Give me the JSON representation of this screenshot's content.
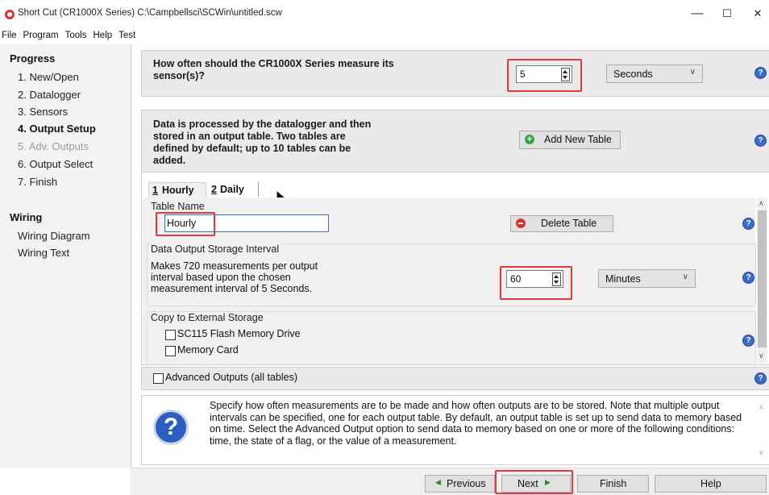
{
  "window": {
    "title": "Short Cut (CR1000X Series) C:\\Campbellsci\\SCWin\\untitled.scw",
    "minimize": "—",
    "maximize": "☐",
    "close": "✕"
  },
  "menu": [
    "File",
    "Program",
    "Tools",
    "Help",
    "Test"
  ],
  "sidebar": {
    "progress_heading": "Progress",
    "items": [
      {
        "label": "1. New/Open",
        "state": "normal"
      },
      {
        "label": "2. Datalogger",
        "state": "normal"
      },
      {
        "label": "3. Sensors",
        "state": "normal"
      },
      {
        "label": "4. Output Setup",
        "state": "current"
      },
      {
        "label": "5. Adv. Outputs",
        "state": "disabled"
      },
      {
        "label": "6. Output Select",
        "state": "normal"
      },
      {
        "label": "7. Finish",
        "state": "normal"
      }
    ],
    "wiring_heading": "Wiring",
    "wiring_items": [
      "Wiring Diagram",
      "Wiring Text"
    ]
  },
  "measure": {
    "question": "How often should the CR1000X Series measure its sensor(s)?",
    "value": "5",
    "unit": "Seconds"
  },
  "tables_info": {
    "text": "Data is processed by the datalogger and then stored in an output table. Two tables are defined by default; up to 10 tables can be added.",
    "add_button": "Add New Table"
  },
  "tabs": [
    {
      "number": "1",
      "name": "Hourly",
      "active": true
    },
    {
      "number": "2",
      "name": "Daily",
      "active": false
    }
  ],
  "table_name": {
    "label": "Table Name",
    "value": "Hourly",
    "delete_button": "Delete Table"
  },
  "interval": {
    "label": "Data Output Storage Interval",
    "description": "Makes 720 measurements per output interval based upon the chosen measurement interval of 5 Seconds.",
    "value": "60",
    "unit": "Minutes"
  },
  "external_storage": {
    "label": "Copy to External Storage",
    "options": [
      "SC115 Flash Memory Drive",
      "Memory Card"
    ]
  },
  "advanced_outputs": "Advanced Outputs (all tables)",
  "help_text": "Specify how often measurements are to be made and how often outputs are to be stored. Note that multiple output intervals can be specified, one for each output table. By default, an output table is set up to send data to memory based on time. Select the Advanced Output option to send data to memory based on one or more of the following conditions: time, the state of a flag, or the value of a measurement.",
  "help_icon_glyph": "?",
  "footer": {
    "previous": "Previous",
    "next": "Next",
    "finish": "Finish",
    "help": "Help"
  },
  "colors": {
    "highlight": "#e0393e",
    "help_icon": "#3a6bc8",
    "add_icon": "#3aa34a",
    "delete_icon": "#d9342b"
  }
}
